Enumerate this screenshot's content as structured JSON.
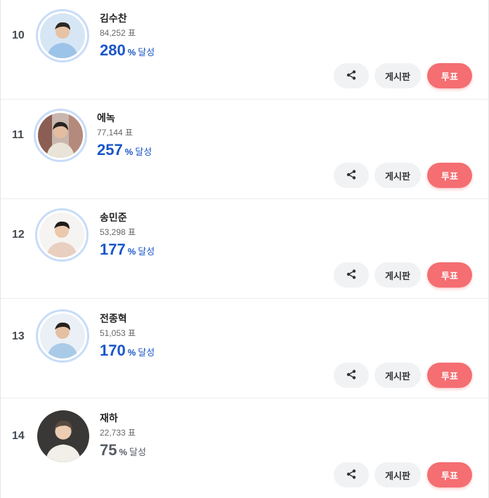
{
  "labels": {
    "vote_unit": "표",
    "percent_unit": "%",
    "achieved": "달성",
    "board_button": "게시판",
    "vote_button": "투표"
  },
  "icons": {
    "share": "share-icon"
  },
  "colors": {
    "accent_blue": "#1a56c8",
    "vote_button": "#f46e72",
    "avatar_ring": "#c8dcf8"
  },
  "rows": [
    {
      "rank": "10",
      "name": "김수찬",
      "votes": "84,252",
      "rate": "280"
    },
    {
      "rank": "11",
      "name": "에녹",
      "votes": "77,144",
      "rate": "257"
    },
    {
      "rank": "12",
      "name": "송민준",
      "votes": "53,298",
      "rate": "177"
    },
    {
      "rank": "13",
      "name": "전종혁",
      "votes": "51,053",
      "rate": "170"
    },
    {
      "rank": "14",
      "name": "재하",
      "votes": "22,733",
      "rate": "75"
    }
  ]
}
